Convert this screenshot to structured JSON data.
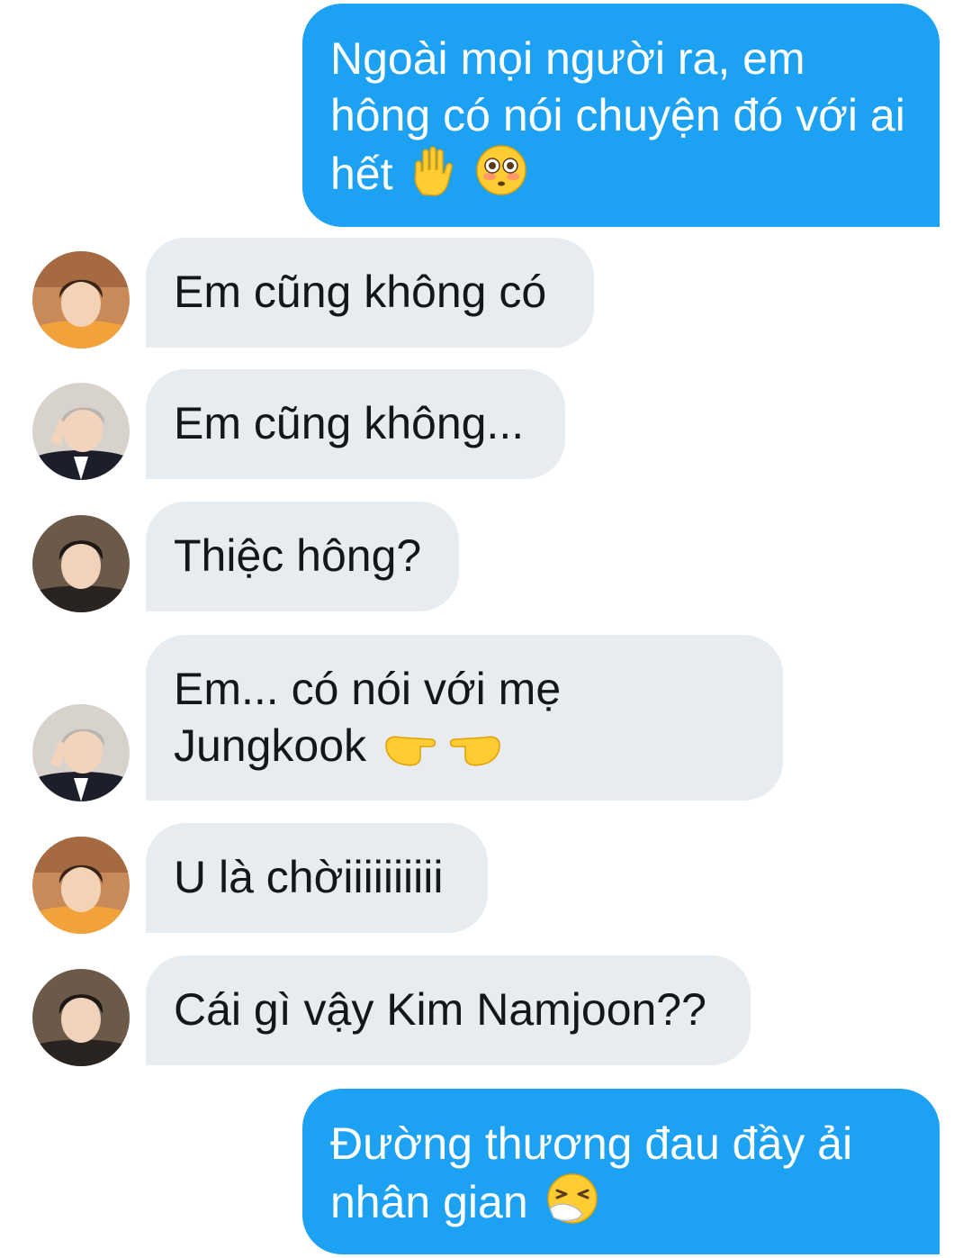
{
  "messages": [
    {
      "sender": "me",
      "text": "Ngoài mọi người ra, em hông có nói chuyện đó với ai hết",
      "emojis": [
        "raised-hand",
        "flushed-face"
      ]
    },
    {
      "sender": "them",
      "avatar": "avatar-orange-shirt",
      "text": "Em cũng không có"
    },
    {
      "sender": "them",
      "avatar": "avatar-silver-hair-suit",
      "text": "Em cũng không..."
    },
    {
      "sender": "them",
      "avatar": "avatar-dark-hair",
      "text": "Thiệc hông?"
    },
    {
      "sender": "them",
      "avatar": "avatar-silver-hair-suit",
      "text": "Em... có nói với mẹ Jungkook",
      "emojis": [
        "pointing-fingers-together"
      ]
    },
    {
      "sender": "them",
      "avatar": "avatar-orange-shirt",
      "text": "U là chờiiiiiiiiii"
    },
    {
      "sender": "them",
      "avatar": "avatar-dark-hair",
      "text": "Cái gì vậy Kim Namjoon??"
    },
    {
      "sender": "me",
      "text": "Đường thương đau đầy ải nhân gian",
      "emojis": [
        "sneezing-face"
      ]
    }
  ],
  "colors": {
    "outgoing_bubble": "#1da1f2",
    "incoming_bubble": "#e6ecf0",
    "outgoing_text": "#ffffff",
    "incoming_text": "#14171a"
  }
}
